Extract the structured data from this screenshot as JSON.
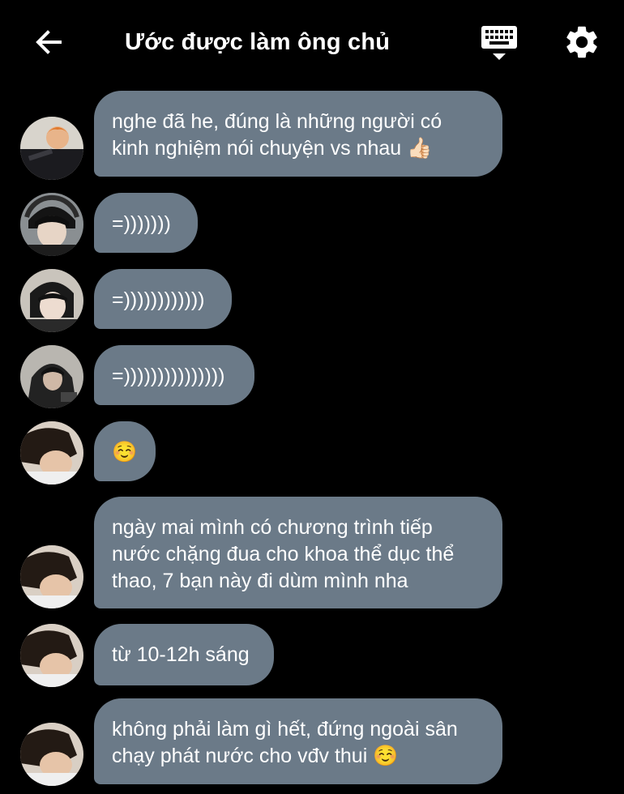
{
  "header": {
    "title": "Ước được làm ông chủ",
    "icons": {
      "back": "arrow-left-icon",
      "keyboard": "keyboard-icon",
      "settings": "gear-icon"
    }
  },
  "colors": {
    "background": "#000000",
    "bubble": "#6b7a88",
    "text": "#ffffff"
  },
  "messages": [
    {
      "text": "nghe đã he, đúng là những người có\nkinh nghiệm nói chuyện vs nhau 👍🏻"
    },
    {
      "text": "=)))))))"
    },
    {
      "text": "=))))))))))))"
    },
    {
      "text": "=)))))))))))))))"
    },
    {
      "text": "☺️"
    },
    {
      "text": "ngày mai mình có chương trình tiếp\nnước chặng đua cho khoa thể dục thể\nthao, 7 bạn này đi dùm mình nha"
    },
    {
      "text": "từ 10-12h sáng"
    },
    {
      "text": "không phải làm gì hết, đứng ngoài sân\nchạy phát nước cho vđv thui ☺️"
    }
  ]
}
